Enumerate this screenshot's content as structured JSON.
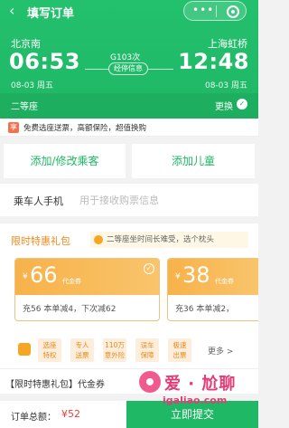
{
  "nav": {
    "back_icon": "back-arrow-icon",
    "title": "填写订单",
    "more": "•••"
  },
  "trip": {
    "departure": {
      "station": "北京南",
      "time": "06:53",
      "date": "08-03 周五"
    },
    "arrival": {
      "station": "上海虹桥",
      "time": "12:48",
      "date": "08-03 周五"
    },
    "train_no": "G103次",
    "stops_label": "经停信息",
    "seat_class": "二等座",
    "change_label": "更换"
  },
  "promo_strip": {
    "tag": "享",
    "text": "免费选座送票，高额保险，超值换购"
  },
  "passengers": {
    "add_adult": "添加/修改乘客",
    "add_child": "添加儿童"
  },
  "phone": {
    "label": "乘车人手机",
    "placeholder": "用于接收购票信息"
  },
  "gift": {
    "title": "限时特惠礼包",
    "hint": "二等座坐时间长难受，选个枕头",
    "coupons": [
      {
        "currency": "¥",
        "amount": "66",
        "unit": "代金券",
        "rule": "充56  本单减4，下次减62"
      },
      {
        "currency": "¥",
        "amount": "38",
        "unit": "代金券",
        "rule": "充36  本单减2，"
      }
    ],
    "perks": [
      "选座\n特权",
      "专人\n送票",
      "110万\n意外险",
      "误车\n保障",
      "极速\n出票"
    ],
    "more": "更多 >"
  },
  "notice": {
    "text": "【限时特惠礼包】代金券"
  },
  "bottom": {
    "total_label": "订单总额：",
    "total_value": "¥52",
    "submit": "立即提交"
  },
  "watermark": {
    "text": "爱 · 尬聊",
    "url": "igaliao.com"
  },
  "colors": {
    "brand_green": "#1fb865",
    "accent_orange": "#f5a623",
    "price_red": "#f03c3c"
  }
}
